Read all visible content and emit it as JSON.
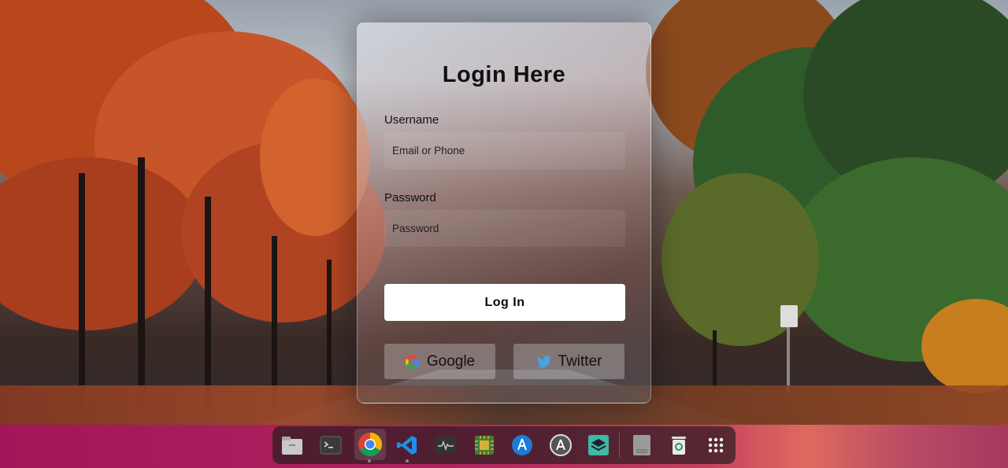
{
  "login": {
    "title": "Login Here",
    "username_label": "Username",
    "username_placeholder": "Email or Phone",
    "password_label": "Password",
    "password_placeholder": "Password",
    "login_button": "Log In",
    "google_button": "Google",
    "twitter_button": "Twitter"
  },
  "dock": {
    "items": [
      {
        "name": "files-icon"
      },
      {
        "name": "terminal-icon"
      },
      {
        "name": "chrome-icon"
      },
      {
        "name": "vscode-icon"
      },
      {
        "name": "system-monitor-icon"
      },
      {
        "name": "cpu-icon"
      },
      {
        "name": "app-store-icon"
      },
      {
        "name": "software-updater-icon"
      },
      {
        "name": "layers-icon"
      },
      {
        "name": "ssd-drive-icon",
        "label": "SSD"
      },
      {
        "name": "trash-icon"
      },
      {
        "name": "app-grid-icon"
      }
    ]
  },
  "colors": {
    "dock_gradient_start": "#a1165a",
    "dock_gradient_end": "#de6a5e",
    "login_button_bg": "#ffffff"
  }
}
